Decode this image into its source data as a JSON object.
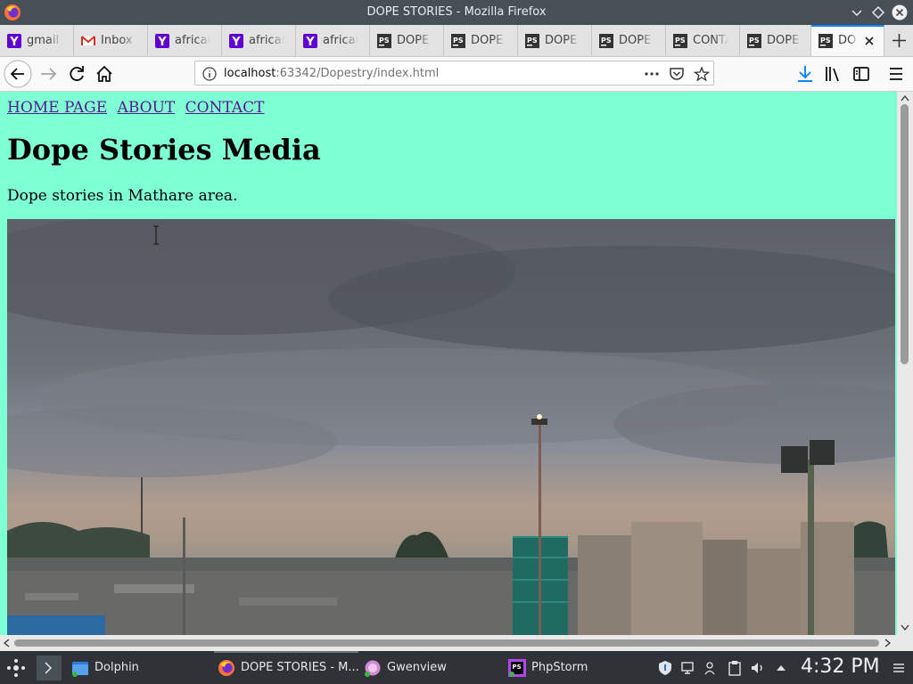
{
  "window": {
    "title": "DOPE STORIES - Mozilla Firefox"
  },
  "tabs": [
    {
      "label": "gmail",
      "icon": "yahoo-icon"
    },
    {
      "label": "Inbox",
      "icon": "gmail-icon"
    },
    {
      "label": "african",
      "icon": "yahoo-icon"
    },
    {
      "label": "african",
      "icon": "yahoo-icon"
    },
    {
      "label": "african",
      "icon": "yahoo-icon"
    },
    {
      "label": "DOPE S",
      "icon": "phpstorm-icon"
    },
    {
      "label": "DOPE S",
      "icon": "phpstorm-icon"
    },
    {
      "label": "DOPE S",
      "icon": "phpstorm-icon"
    },
    {
      "label": "DOPE S",
      "icon": "phpstorm-icon"
    },
    {
      "label": "CONTA",
      "icon": "phpstorm-icon"
    },
    {
      "label": "DOPE S",
      "icon": "phpstorm-icon"
    },
    {
      "label": "DOPE",
      "icon": "phpstorm-icon",
      "active": true
    }
  ],
  "urlbar": {
    "host": "localhost",
    "port_path": ":63342/Dopestry/index.html"
  },
  "page": {
    "nav": [
      "HOME PAGE",
      "ABOUT",
      "CONTACT"
    ],
    "heading": "Dope Stories Media",
    "tagline": "Dope stories in Mathare area.",
    "background_color": "#7fffd4",
    "link_color": "#551a8b"
  },
  "taskbar": {
    "items": [
      {
        "label": "Dolphin",
        "icon": "dolphin-icon"
      },
      {
        "label": "DOPE STORIES - M...",
        "icon": "firefox-icon",
        "active": true
      },
      {
        "label": "Gwenview",
        "icon": "gwenview-icon"
      },
      {
        "label": "PhpStorm",
        "icon": "phpstorm-icon"
      }
    ],
    "clock": "4:32 PM"
  }
}
